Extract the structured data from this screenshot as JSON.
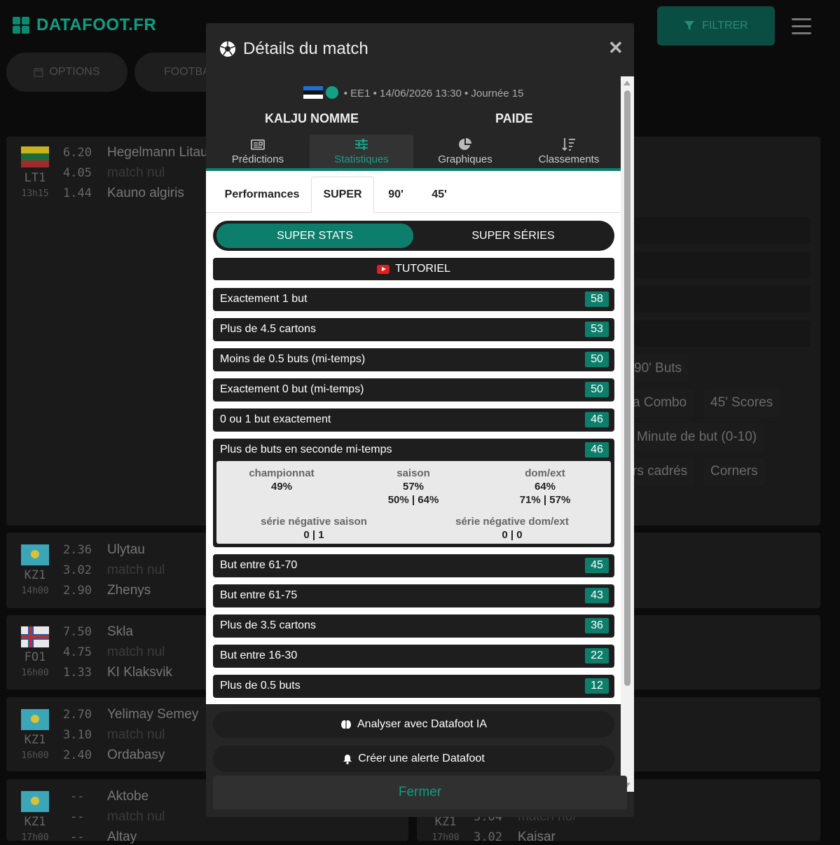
{
  "app": {
    "logo_text": "DATAFOOT.FR",
    "filter_label": "FILTRER"
  },
  "pills": [
    {
      "label": "OPTIONS",
      "icon": "calendar-icon"
    },
    {
      "label": "FOOTBA"
    }
  ],
  "background_matches": [
    {
      "league": "LT1",
      "time": "13h15",
      "odds": [
        "6.20",
        "4.05",
        "1.44"
      ],
      "home": "Hegelmann Litau",
      "draw": "match nul",
      "away": "Kauno algiris"
    },
    {
      "league": "KZ1",
      "time": "14h00",
      "odds": [
        "2.36",
        "3.02",
        "2.90"
      ],
      "home": "Ulytau",
      "draw": "match nul",
      "away": "Zhenys"
    },
    {
      "league": "FO1",
      "time": "16h00",
      "odds": [
        "7.50",
        "4.75",
        "1.33"
      ],
      "home": "Skla",
      "draw": "match nul",
      "away": "KI Klaksvik"
    },
    {
      "league": "KZ1",
      "time": "16h00",
      "odds": [
        "2.70",
        "3.10",
        "2.40"
      ],
      "home": "Yelimay Semey",
      "draw": "match nul",
      "away": "Ordabasy"
    },
    {
      "league": "KZ1",
      "time": "17h00",
      "odds": [
        "--",
        "--",
        "--"
      ],
      "home": "Aktobe",
      "draw": "match nul",
      "away": "Altay"
    }
  ],
  "background_right_match": {
    "league": "KZ1",
    "time": "17h00",
    "odds": [
      "3.04",
      "3.02"
    ],
    "draw": "match nul",
    "away": "Kaisar"
  },
  "background_chips": [
    "90' Buts",
    "a Combo",
    "45' Scores",
    "Minute de but (0-10)",
    "rs cadrés",
    "Corners"
  ],
  "modal": {
    "title": "Détails du match",
    "meta": "• EE1 • 14/06/2026 13:30 • Journée 15",
    "home_team": "KALJU NOMME",
    "away_team": "PAIDE",
    "tabs": [
      {
        "label": "Prédictions",
        "icon": "newspaper-icon"
      },
      {
        "label": "Statistiques",
        "icon": "sliders-icon"
      },
      {
        "label": "Graphiques",
        "icon": "pie-chart-icon"
      },
      {
        "label": "Classements",
        "icon": "sort-icon"
      }
    ],
    "subtabs": [
      "Performances",
      "SUPER",
      "90'",
      "45'"
    ],
    "toggle": {
      "on": "SUPER STATS",
      "off": "SUPER SÉRIES"
    },
    "tutorial": "TUTORIEL",
    "stats": [
      {
        "label": "Exactement 1 but",
        "value": "58"
      },
      {
        "label": "Plus de 4.5 cartons",
        "value": "53"
      },
      {
        "label": "Moins de 0.5 buts (mi-temps)",
        "value": "50"
      },
      {
        "label": "Exactement 0 but (mi-temps)",
        "value": "50"
      },
      {
        "label": "0 ou 1 but exactement",
        "value": "46"
      },
      {
        "label": "Plus de buts en seconde mi-temps",
        "value": "46"
      },
      {
        "label": "But entre 61-70",
        "value": "45"
      },
      {
        "label": "But entre 61-75",
        "value": "43"
      },
      {
        "label": "Plus de 3.5 cartons",
        "value": "36"
      },
      {
        "label": "But entre 16-30",
        "value": "22"
      },
      {
        "label": "Plus de 0.5 buts",
        "value": "12"
      }
    ],
    "expanded_detail": {
      "championnat": {
        "label": "championnat",
        "value": "49%"
      },
      "saison": {
        "label": "saison",
        "value": "57%",
        "split": "50% | 64%"
      },
      "domext": {
        "label": "dom/ext",
        "value": "64%",
        "split": "71% | 57%"
      },
      "serie_saison": {
        "label": "série négative saison",
        "value": "0 | 1"
      },
      "serie_domext": {
        "label": "série négative dom/ext",
        "value": "0 | 0"
      }
    },
    "actions": {
      "analyse": "Analyser avec Datafoot IA",
      "alerte": "Créer une alerte Datafoot"
    },
    "close_label": "Fermer"
  },
  "colors": {
    "accent": "#0e7e6c",
    "accent_text": "#15a085",
    "modal_bg": "#262626"
  }
}
